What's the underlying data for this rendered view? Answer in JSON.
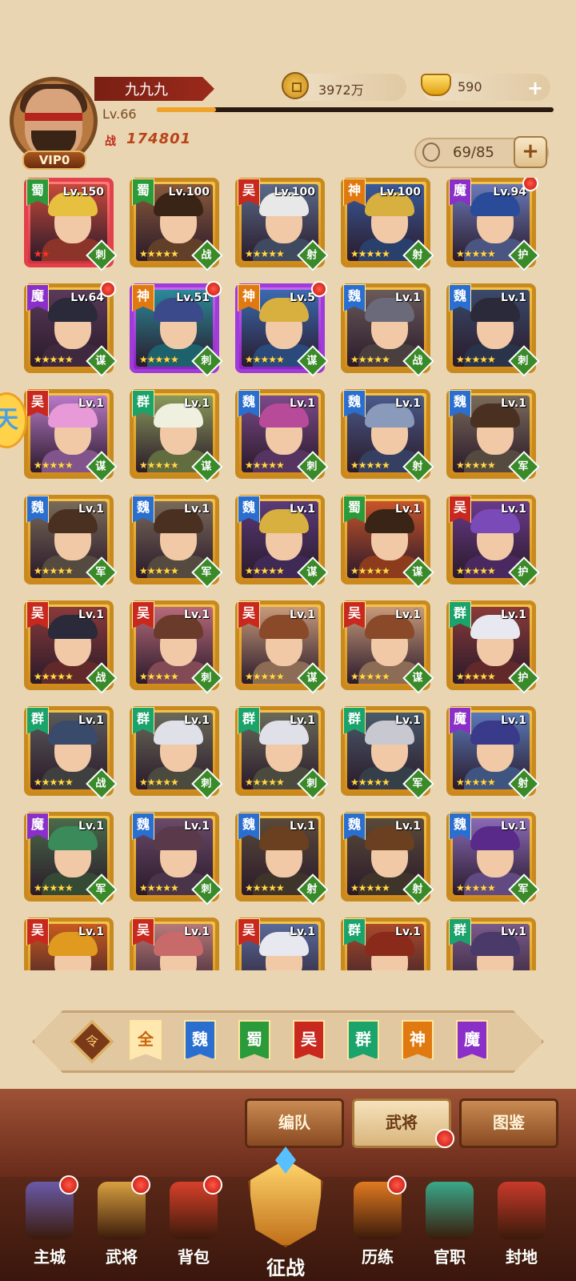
{
  "player": {
    "name": "九九九",
    "level": "Lv.66",
    "level_progress_percent": 15,
    "vip": "VIP0",
    "power": "174801",
    "power_icon_text": "战"
  },
  "resources": {
    "copper": "3972万",
    "gold": "590",
    "add_symbol": "+"
  },
  "hero_capacity": "69/85",
  "side_badge_text": "天",
  "colors": {
    "wei": "#2a6fd0",
    "shu": "#2a9a3a",
    "wu": "#c8281e",
    "qun": "#1aa36a",
    "shen": "#e07a10",
    "mo": "#8a30c8",
    "role_bg": "#3a8a2a"
  },
  "heroes": [
    {
      "faction": "蜀",
      "level": "Lv.150",
      "stars": "★★",
      "star_color": "red",
      "role": "刺",
      "frame": "red",
      "dot": false,
      "hair": "#e8c040",
      "bg": "#c84a3a"
    },
    {
      "faction": "蜀",
      "level": "Lv.100",
      "stars": "★★★★★",
      "role": "战",
      "frame": "gold",
      "dot": false,
      "hair": "#3a2416",
      "bg": "#8a5a3a"
    },
    {
      "faction": "吴",
      "level": "Lv.100",
      "stars": "★★★★★",
      "role": "射",
      "frame": "gold",
      "dot": false,
      "hair": "#e8e8e8",
      "bg": "#5a6a8a"
    },
    {
      "faction": "神",
      "level": "Lv.100",
      "stars": "★★★★★",
      "role": "射",
      "frame": "gold",
      "dot": false,
      "hair": "#d8b040",
      "bg": "#3a5a9a"
    },
    {
      "faction": "魔",
      "level": "Lv.94",
      "stars": "★★★★★",
      "role": "护",
      "frame": "gold",
      "dot": true,
      "hair": "#2a4a9a",
      "bg": "#6a7ab8"
    },
    {
      "faction": "魔",
      "level": "Lv.64",
      "stars": "★★★★★",
      "role": "谋",
      "frame": "gold",
      "dot": true,
      "hair": "#2a2a3a",
      "bg": "#5a3a5a"
    },
    {
      "faction": "神",
      "level": "Lv.51",
      "stars": "★★★★★",
      "role": "刺",
      "frame": "purple",
      "dot": true,
      "hair": "#3a4a8a",
      "bg": "#2a8a9a"
    },
    {
      "faction": "神",
      "level": "Lv.5",
      "stars": "★★★★★",
      "role": "谋",
      "frame": "purple",
      "dot": true,
      "hair": "#d8b040",
      "bg": "#3a6ab0"
    },
    {
      "faction": "魏",
      "level": "Lv.1",
      "stars": "★★★★★",
      "role": "战",
      "frame": "gold",
      "dot": false,
      "hair": "#6a6a7a",
      "bg": "#6a5a5a"
    },
    {
      "faction": "魏",
      "level": "Lv.1",
      "stars": "★★★★★",
      "role": "刺",
      "frame": "gold",
      "dot": false,
      "hair": "#2a2a3a",
      "bg": "#3a4a6a"
    },
    {
      "faction": "吴",
      "level": "Lv.1",
      "stars": "★★★★★",
      "role": "谋",
      "frame": "gold",
      "dot": false,
      "hair": "#e89ad8",
      "bg": "#b87ac8"
    },
    {
      "faction": "群",
      "level": "Lv.1",
      "stars": "★★★★★",
      "role": "谋",
      "frame": "gold",
      "dot": false,
      "hair": "#f0f0e0",
      "bg": "#8a9a5a"
    },
    {
      "faction": "魏",
      "level": "Lv.1",
      "stars": "★★★★★",
      "role": "刺",
      "frame": "gold",
      "dot": false,
      "hair": "#b84a9a",
      "bg": "#7a4a8a"
    },
    {
      "faction": "魏",
      "level": "Lv.1",
      "stars": "★★★★★",
      "role": "射",
      "frame": "gold",
      "dot": false,
      "hair": "#8a9aba",
      "bg": "#4a5a8a"
    },
    {
      "faction": "魏",
      "level": "Lv.1",
      "stars": "★★★★★",
      "role": "军",
      "frame": "gold",
      "dot": false,
      "hair": "#4a3020",
      "bg": "#7a6a5a"
    },
    {
      "faction": "魏",
      "level": "Lv.1",
      "stars": "★★★★★",
      "role": "军",
      "frame": "gold",
      "dot": false,
      "hair": "#4a3020",
      "bg": "#7a6a5a"
    },
    {
      "faction": "魏",
      "level": "Lv.1",
      "stars": "★★★★★",
      "role": "军",
      "frame": "gold",
      "dot": false,
      "hair": "#4a3020",
      "bg": "#7a6a5a"
    },
    {
      "faction": "魏",
      "level": "Lv.1",
      "stars": "★★★★★",
      "role": "谋",
      "frame": "gold",
      "dot": false,
      "hair": "#d8b040",
      "bg": "#5a3a7a"
    },
    {
      "faction": "蜀",
      "level": "Lv.1",
      "stars": "★★★★★",
      "role": "谋",
      "frame": "gold",
      "dot": false,
      "hair": "#3a2416",
      "bg": "#c8542a"
    },
    {
      "faction": "吴",
      "level": "Lv.1",
      "stars": "★★★★★",
      "role": "护",
      "frame": "gold",
      "dot": false,
      "hair": "#7a4ab8",
      "bg": "#6a3a8a"
    },
    {
      "faction": "吴",
      "level": "Lv.1",
      "stars": "★★★★★",
      "role": "战",
      "frame": "gold",
      "dot": false,
      "hair": "#2a2a3a",
      "bg": "#8a3a3a"
    },
    {
      "faction": "吴",
      "level": "Lv.1",
      "stars": "★★★★★",
      "role": "刺",
      "frame": "gold",
      "dot": false,
      "hair": "#6a3a2a",
      "bg": "#b86a7a"
    },
    {
      "faction": "吴",
      "level": "Lv.1",
      "stars": "★★★★★",
      "role": "谋",
      "frame": "gold",
      "dot": false,
      "hair": "#8a4a2a",
      "bg": "#c89a7a"
    },
    {
      "faction": "吴",
      "level": "Lv.1",
      "stars": "★★★★★",
      "role": "谋",
      "frame": "gold",
      "dot": false,
      "hair": "#8a4a2a",
      "bg": "#c89a7a"
    },
    {
      "faction": "群",
      "level": "Lv.1",
      "stars": "★★★★★",
      "role": "护",
      "frame": "gold",
      "dot": false,
      "hair": "#e8e8f0",
      "bg": "#8a3a3a"
    },
    {
      "faction": "群",
      "level": "Lv.1",
      "stars": "★★★★★",
      "role": "战",
      "frame": "gold",
      "dot": false,
      "hair": "#3a4a6a",
      "bg": "#5a5a5a"
    },
    {
      "faction": "群",
      "level": "Lv.1",
      "stars": "★★★★★",
      "role": "刺",
      "frame": "gold",
      "dot": false,
      "hair": "#e0e0e8",
      "bg": "#6a6a5a"
    },
    {
      "faction": "群",
      "level": "Lv.1",
      "stars": "★★★★★",
      "role": "刺",
      "frame": "gold",
      "dot": false,
      "hair": "#e0e0e8",
      "bg": "#6a6a5a"
    },
    {
      "faction": "群",
      "level": "Lv.1",
      "stars": "★★★★★",
      "role": "军",
      "frame": "gold",
      "dot": false,
      "hair": "#c8c8d0",
      "bg": "#4a5a6a"
    },
    {
      "faction": "魔",
      "level": "Lv.1",
      "stars": "★★★★★",
      "role": "射",
      "frame": "gold",
      "dot": false,
      "hair": "#3a3a8a",
      "bg": "#5a7ab8"
    },
    {
      "faction": "魔",
      "level": "Lv.1",
      "stars": "★★★★★",
      "role": "军",
      "frame": "gold",
      "dot": false,
      "hair": "#3a8a5a",
      "bg": "#4a6a4a"
    },
    {
      "faction": "魏",
      "level": "Lv.1",
      "stars": "★★★★★",
      "role": "刺",
      "frame": "gold",
      "dot": false,
      "hair": "#5a3a4a",
      "bg": "#6a4a6a"
    },
    {
      "faction": "魏",
      "level": "Lv.1",
      "stars": "★★★★★",
      "role": "射",
      "frame": "gold",
      "dot": false,
      "hair": "#6a4020",
      "bg": "#5a4a3a"
    },
    {
      "faction": "魏",
      "level": "Lv.1",
      "stars": "★★★★★",
      "role": "射",
      "frame": "gold",
      "dot": false,
      "hair": "#6a4020",
      "bg": "#5a4a3a"
    },
    {
      "faction": "魏",
      "level": "Lv.1",
      "stars": "★★★★★",
      "role": "军",
      "frame": "gold",
      "dot": false,
      "hair": "#5a2a8a",
      "bg": "#8a6ab8"
    },
    {
      "faction": "吴",
      "level": "Lv.1",
      "stars": "",
      "role": "",
      "frame": "gold",
      "dot": false,
      "hair": "#e09a20",
      "bg": "#c85a20"
    },
    {
      "faction": "吴",
      "level": "Lv.1",
      "stars": "",
      "role": "",
      "frame": "gold",
      "dot": false,
      "hair": "#c86a6a",
      "bg": "#b87a7a"
    },
    {
      "faction": "吴",
      "level": "Lv.1",
      "stars": "",
      "role": "",
      "frame": "gold",
      "dot": false,
      "hair": "#e8e8f0",
      "bg": "#5a6a9a"
    },
    {
      "faction": "群",
      "level": "Lv.1",
      "stars": "",
      "role": "",
      "frame": "gold",
      "dot": false,
      "hair": "#8a2a1a",
      "bg": "#a84a2a"
    },
    {
      "faction": "群",
      "level": "Lv.1",
      "stars": "",
      "role": "",
      "frame": "gold",
      "dot": false,
      "hair": "#4a3a6a",
      "bg": "#7a5a8a"
    }
  ],
  "filter": {
    "sort_icon_text": "令",
    "tabs": [
      {
        "label": "全",
        "active": true
      },
      {
        "label": "魏",
        "active": false
      },
      {
        "label": "蜀",
        "active": false
      },
      {
        "label": "吴",
        "active": false
      },
      {
        "label": "群",
        "active": false
      },
      {
        "label": "神",
        "active": false
      },
      {
        "label": "魔",
        "active": false
      }
    ]
  },
  "subtabs": [
    {
      "label": "编队",
      "active": false
    },
    {
      "label": "武将",
      "active": true
    },
    {
      "label": "图鉴",
      "active": false
    }
  ],
  "nav": [
    {
      "label": "主城",
      "dot": true,
      "color": "#6a5aa8"
    },
    {
      "label": "武将",
      "dot": true,
      "color": "#d8a040"
    },
    {
      "label": "背包",
      "dot": true,
      "color": "#d8402a"
    },
    {
      "label": "征战",
      "dot": false,
      "color": "#e0a030"
    },
    {
      "label": "历练",
      "dot": true,
      "color": "#e07a20"
    },
    {
      "label": "官职",
      "dot": false,
      "color": "#3aa88a"
    },
    {
      "label": "封地",
      "dot": false,
      "color": "#c83a2a"
    }
  ]
}
